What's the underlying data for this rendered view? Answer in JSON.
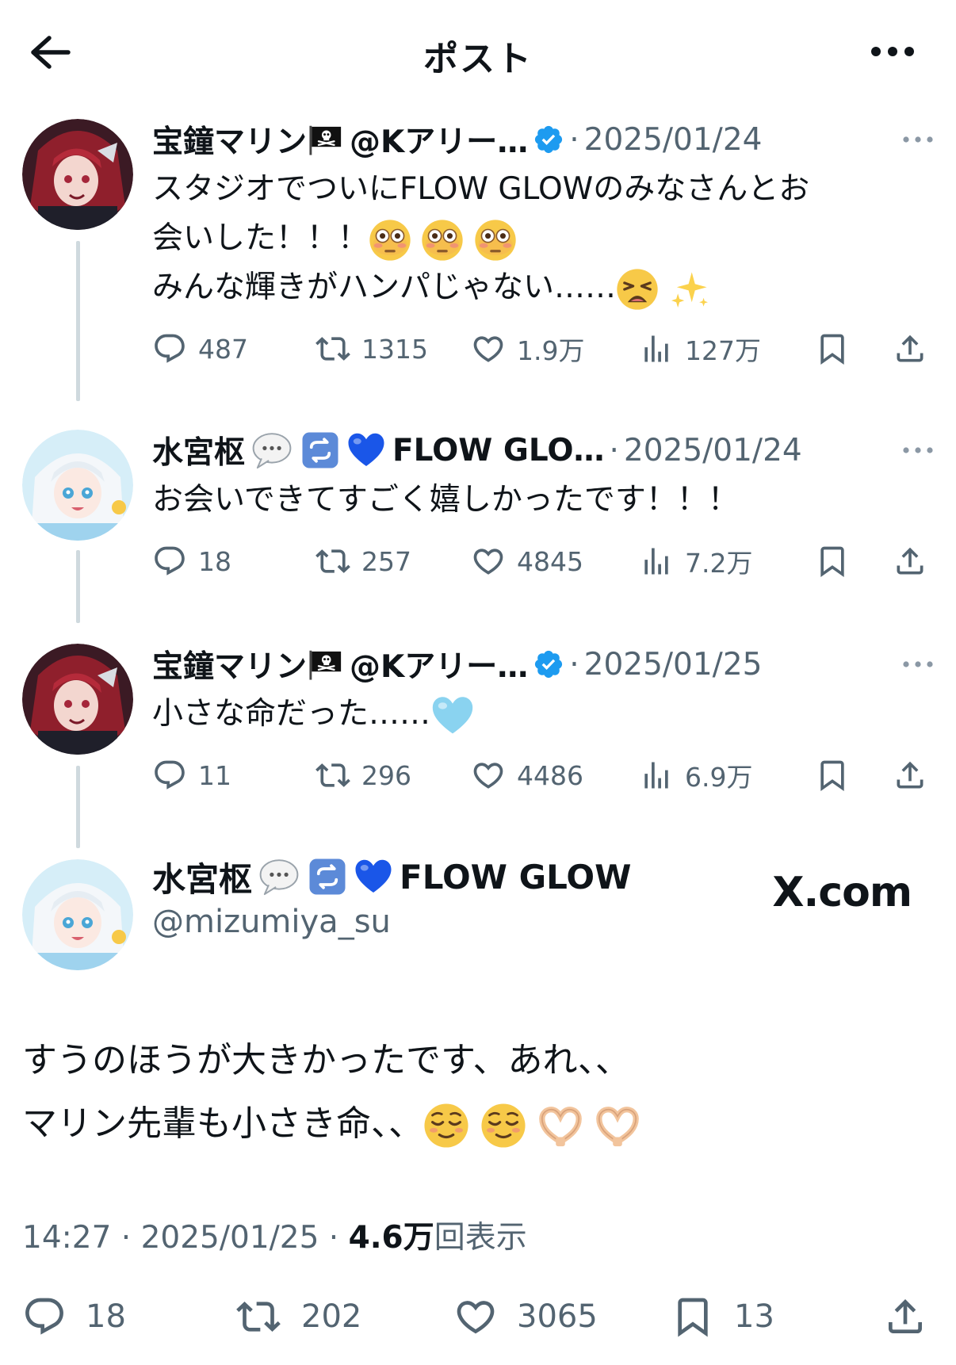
{
  "header": {
    "title": "ポスト"
  },
  "replies": [
    {
      "name": "宝鐘マリン",
      "handle": "@Kアリー…",
      "date": "2025/01/24",
      "text_line1": "スタジオでついにFLOW GLOWのみなさんとお",
      "text_line2": "会いした！！！",
      "text_line3": "みんな輝きがハンパじゃない……",
      "replies": "487",
      "reposts": "1315",
      "likes": "1.9万",
      "views": "127万"
    },
    {
      "name": "水宮枢",
      "handle": "FLOW GLO…",
      "date": "2025/01/24",
      "text_line1": "お会いできてすごく嬉しかったです！！！",
      "replies": "18",
      "reposts": "257",
      "likes": "4845",
      "views": "7.2万"
    },
    {
      "name": "宝鐘マリン",
      "handle": "@Kアリー…",
      "date": "2025/01/25",
      "text_line1": "小さな命だった……",
      "replies": "11",
      "reposts": "296",
      "likes": "4486",
      "views": "6.9万"
    }
  ],
  "main": {
    "name": "水宮枢",
    "name_suffix": "FLOW GLOW",
    "handle": "@mizumiya_su",
    "watermark": "X.com",
    "text_line1": "すうのほうが大きかったです、あれ、、",
    "text_line2": "マリン先輩も小さき命、、",
    "time": "14:27",
    "date": "2025/01/25",
    "views_count": "4.6万",
    "views_label": "回表示",
    "replies": "18",
    "reposts": "202",
    "likes": "3065",
    "bookmarks": "13"
  },
  "colors": {
    "verified": "#1d9bf0",
    "text": "#0f1419",
    "secondary": "#536471",
    "thread_line": "#cfd9de"
  }
}
